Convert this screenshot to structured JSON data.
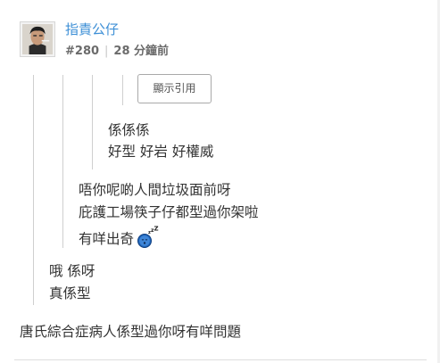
{
  "post": {
    "username": "指責公仔",
    "post_number": "#280",
    "separator": "|",
    "time_ago": "28 分鐘前"
  },
  "quotes": {
    "show_quote_label": "顯示引用",
    "level3": [
      "係係係",
      "好型 好岩 好權威"
    ],
    "level2": [
      "唔你呢啲人間垃圾面前呀",
      "庇護工場筷子仔都型過你架啦",
      "有咩出奇"
    ],
    "level1": [
      "哦 係呀",
      "真係型"
    ]
  },
  "reply": {
    "text": "唐氏綜合症病人係型過你呀有咩問題"
  },
  "icons": {
    "avatar": "avatar-photo",
    "emoji": "sleeping-emoji"
  },
  "colors": {
    "username": "#3d8fd6",
    "quote_line": "#cfcfcf",
    "emoji_blue": "#1f64b8"
  }
}
